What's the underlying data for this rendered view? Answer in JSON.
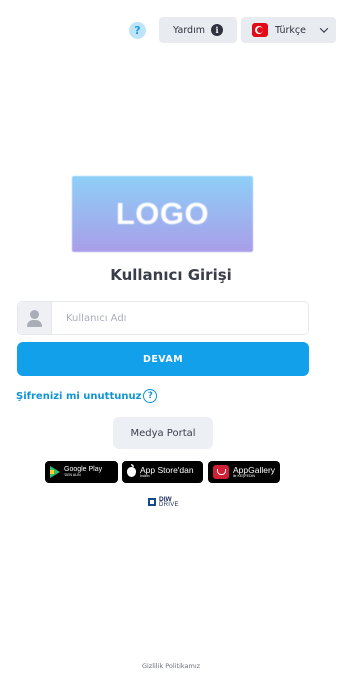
{
  "header": {
    "help_icon_glyph": "?",
    "help_label": "Yardım",
    "info_icon_glyph": "i",
    "language_label": "Türkçe"
  },
  "logo": {
    "text": "LOGO"
  },
  "login": {
    "title": "Kullanıcı Girişi",
    "username_placeholder": "Kullanıcı Adı",
    "username_value": "",
    "submit_label": "DEVAM",
    "forgot_label": "Şifrenizi mi unuttunuz",
    "forgot_icon_glyph": "?"
  },
  "media_portal_label": "Medya Portal",
  "store_badges": {
    "google": {
      "big": "Google Play",
      "small": "'DEN ALIN"
    },
    "apple": {
      "big": "App Store'dan",
      "small": "İndirin"
    },
    "huawei": {
      "big": "AppGallery",
      "small": "ile KEŞFEDİN"
    }
  },
  "brand": {
    "line1": "DIW",
    "line2": "DRIVE"
  },
  "footer": {
    "privacy_label": "Gizlilik Politikamız"
  },
  "colors": {
    "primary": "#12a0ea",
    "link": "#1195d8",
    "button_gray": "#e8ebf0",
    "flag_red": "#e30a17"
  }
}
